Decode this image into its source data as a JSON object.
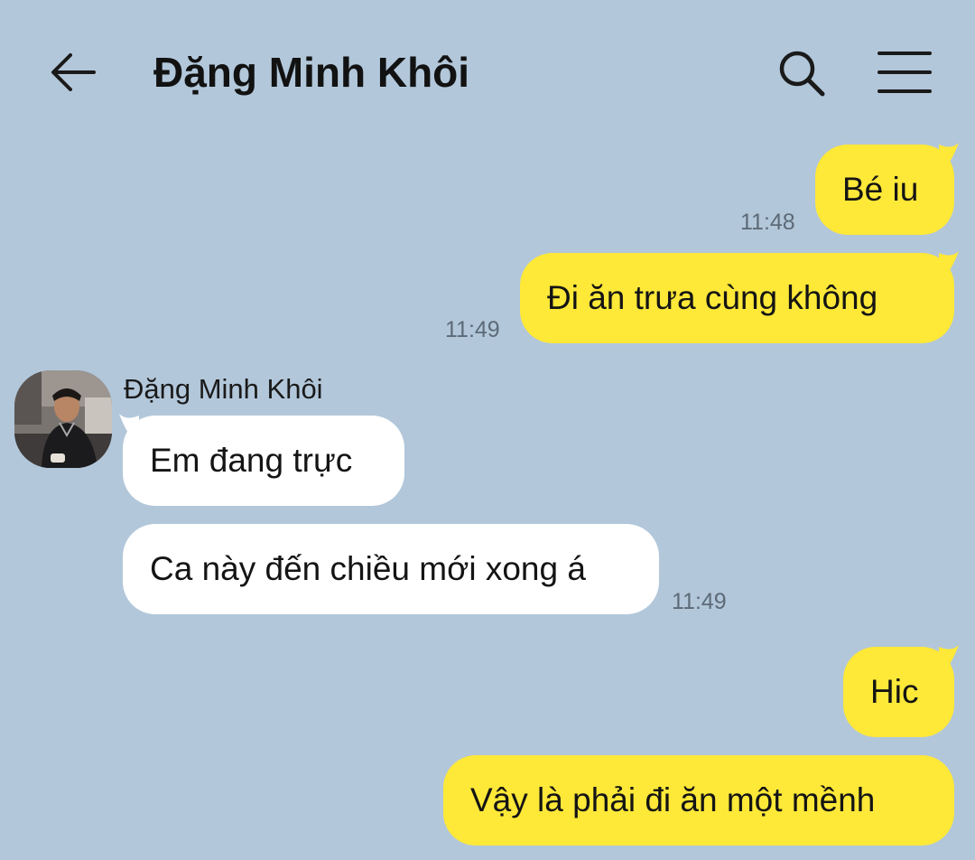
{
  "header": {
    "title": "Đặng Minh Khôi",
    "back_icon": "arrow-left-icon",
    "search_icon": "search-icon",
    "menu_icon": "hamburger-menu-icon"
  },
  "colors": {
    "background": "#b2c7da",
    "my_bubble": "#fee838",
    "their_bubble": "#ffffff",
    "timestamp": "#5d6a77"
  },
  "contact": {
    "name": "Đặng Minh Khôi",
    "avatar_icon": "contact-avatar"
  },
  "messages": [
    {
      "sender": "me",
      "text": "Bé iu",
      "time": "11:48"
    },
    {
      "sender": "me",
      "text": "Đi ăn trưa cùng không",
      "time": "11:49"
    },
    {
      "sender": "them",
      "text": "Em đang trực",
      "time": ""
    },
    {
      "sender": "them",
      "text": "Ca này đến chiều mới xong á",
      "time": "11:49"
    },
    {
      "sender": "me",
      "text": "Hic",
      "time": ""
    },
    {
      "sender": "me",
      "text": "Vậy là phải đi ăn một mềnh",
      "time": ""
    }
  ]
}
